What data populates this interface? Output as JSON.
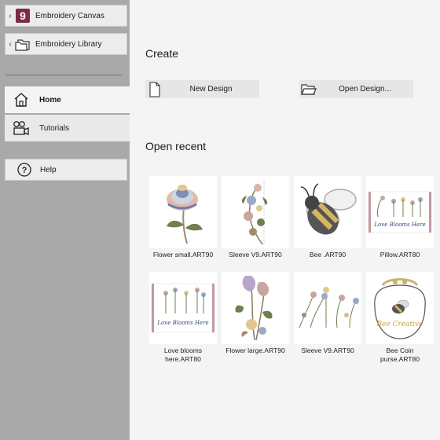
{
  "sidebar": {
    "canvas_label": "Embroidery Canvas",
    "library_label": "Embroidery Library",
    "canvas_badge": "9",
    "home_label": "Home",
    "tutorials_label": "Tutorials",
    "help_label": "Help"
  },
  "main": {
    "create_heading": "Create",
    "new_design_label": "New Design",
    "open_design_label": "Open Design...",
    "recent_heading": "Open recent",
    "recent": [
      {
        "name": "Flower small.ART90",
        "icon": "flower-small-thumbnail"
      },
      {
        "name": "Sleeve V9.ART90",
        "icon": "sleeve-thumbnail"
      },
      {
        "name": "Bee .ART90",
        "icon": "bee-thumbnail"
      },
      {
        "name": "Pillow.ART80",
        "icon": "pillow-thumbnail"
      },
      {
        "name": "Love blooms here.ART80",
        "icon": "love-blooms-thumbnail"
      },
      {
        "name": "Flower large.ART90",
        "icon": "flower-large-thumbnail"
      },
      {
        "name": "Sleeve V9.ART90",
        "icon": "sleeve-thumbnail"
      },
      {
        "name": "Bee Coin purse.ART80",
        "icon": "bee-coin-purse-thumbnail"
      }
    ]
  },
  "art": {
    "pillow_text": "Love Blooms Here",
    "purse_text": "Bee Creative"
  },
  "colors": {
    "sidebar_bg": "#a9a9a9",
    "badge_bg": "#7a2b45",
    "main_bg": "#f4f4f4"
  }
}
